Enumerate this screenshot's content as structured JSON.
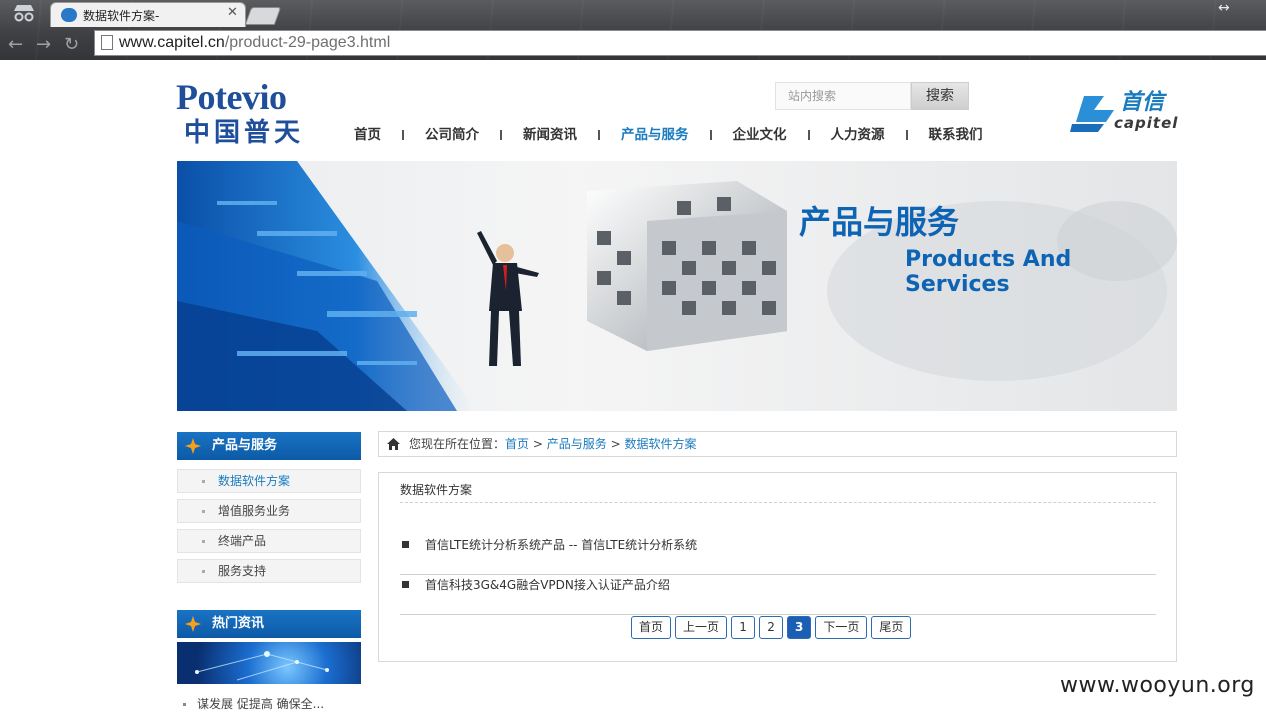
{
  "browser": {
    "tab_title": "数据软件方案-",
    "tab_close": "✕",
    "url_domain": "www.capitel.cn",
    "url_path": "/product-29-page3.html"
  },
  "header": {
    "logo_potevio_en": "Potevio",
    "logo_potevio_cn": "中国普天",
    "search_placeholder": "站内搜索",
    "search_button": "搜索",
    "logo_capitel_cn": "首信",
    "logo_capitel_en": "capitel",
    "nav": [
      {
        "label": "首页",
        "active": false
      },
      {
        "label": "公司简介",
        "active": false
      },
      {
        "label": "新闻资讯",
        "active": false
      },
      {
        "label": "产品与服务",
        "active": true
      },
      {
        "label": "企业文化",
        "active": false
      },
      {
        "label": "人力资源",
        "active": false
      },
      {
        "label": "联系我们",
        "active": false
      }
    ]
  },
  "banner": {
    "title_cn": "产品与服务",
    "title_en": "Products And Services"
  },
  "sidebar": {
    "section_title": "产品与服务",
    "items": [
      {
        "label": "数据软件方案",
        "active": true
      },
      {
        "label": "增值服务业务",
        "active": false
      },
      {
        "label": "终端产品",
        "active": false
      },
      {
        "label": "服务支持",
        "active": false
      }
    ],
    "hot_title": "热门资讯",
    "hot_item": "谋发展 促提高 确保全..."
  },
  "breadcrumb": {
    "prefix": "您现在所在位置：",
    "home": "首页",
    "sep": ">",
    "category": "产品与服务",
    "current": "数据软件方案"
  },
  "content": {
    "title": "数据软件方案",
    "articles": [
      "首信LTE统计分析系统产品 -- 首信LTE统计分析系统",
      "首信科技3G&4G融合VPDN接入认证产品介绍"
    ],
    "pager": {
      "first": "首页",
      "prev": "上一页",
      "pages": [
        "1",
        "2",
        "3"
      ],
      "current": "3",
      "next": "下一页",
      "last": "尾页"
    }
  },
  "watermark": "www.wooyun.org",
  "colors": {
    "brand_blue": "#1a7bbf",
    "nav_active": "#1a7bbf",
    "sidebar_header": "#0c5aa6"
  }
}
